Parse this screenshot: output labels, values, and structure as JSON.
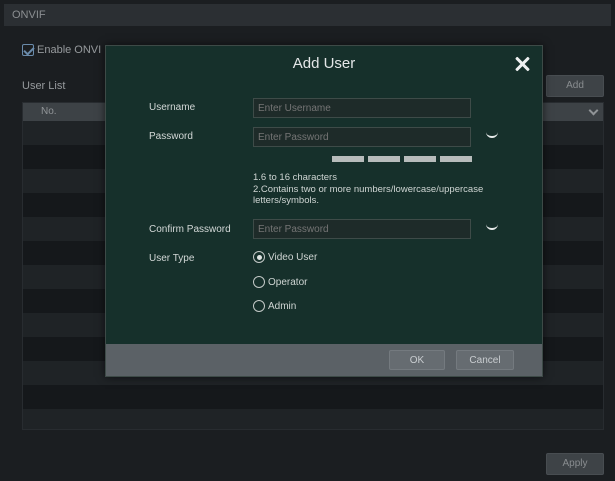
{
  "panel": {
    "title": "ONVIF",
    "enable_label": "Enable ONVI",
    "user_list_label": "User List",
    "add_label": "Add",
    "table_header_no": "No.",
    "apply_label": "Apply"
  },
  "dialog": {
    "title": "Add User",
    "username_label": "Username",
    "username_placeholder": "Enter Username",
    "password_label": "Password",
    "password_placeholder": "Enter Password",
    "hint_line1": "1.6 to 16 characters",
    "hint_line2": "2.Contains two or more numbers/lowercase/uppercase letters/symbols.",
    "confirm_label": "Confirm Password",
    "confirm_placeholder": "Enter Password",
    "user_type_label": "User Type",
    "user_types": [
      "Video User",
      "Operator",
      "Admin"
    ],
    "selected_user_type": "Video User",
    "ok_label": "OK",
    "cancel_label": "Cancel"
  }
}
